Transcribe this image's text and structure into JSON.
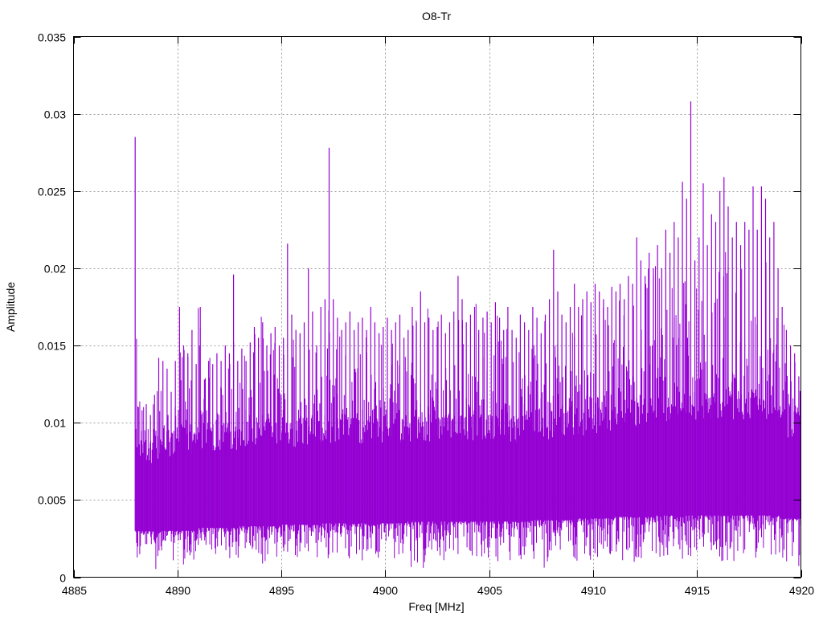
{
  "chart_data": {
    "type": "line",
    "title": "O8-Tr",
    "xlabel": "Freq [MHz]",
    "ylabel": "Amplitude",
    "xlim": [
      4885,
      4920
    ],
    "ylim": [
      0,
      0.035
    ],
    "grid": true,
    "legend": "none",
    "series_color": "#9400d3",
    "xticks": [
      4885,
      4890,
      4895,
      4900,
      4905,
      4910,
      4915,
      4920
    ],
    "xtick_labels": [
      "4885",
      "4890",
      "4895",
      "4900",
      "4905",
      "4910",
      "4915",
      "4920"
    ],
    "yticks": [
      0,
      0.005,
      0.01,
      0.015,
      0.02,
      0.025,
      0.03,
      0.035
    ],
    "ytick_labels": [
      "0",
      "0.005",
      "0.01",
      "0.015",
      "0.02",
      "0.025",
      "0.03",
      "0.035"
    ],
    "envelope": {
      "x_start": 4888.0,
      "bin_width_mhz": 0.2,
      "max": [
        0.0285,
        0.0108,
        0.0112,
        0.0105,
        0.0118,
        0.0142,
        0.014,
        0.0135,
        0.012,
        0.014,
        0.0175,
        0.015,
        0.0145,
        0.016,
        0.0138,
        0.0175,
        0.0128,
        0.014,
        0.0138,
        0.0145,
        0.014,
        0.015,
        0.0145,
        0.0196,
        0.014,
        0.0148,
        0.014,
        0.0152,
        0.0162,
        0.0155,
        0.0165,
        0.015,
        0.0158,
        0.0162,
        0.015,
        0.0155,
        0.0216,
        0.017,
        0.016,
        0.0158,
        0.0165,
        0.02,
        0.0172,
        0.015,
        0.0175,
        0.018,
        0.0278,
        0.018,
        0.0168,
        0.016,
        0.0165,
        0.0172,
        0.016,
        0.0165,
        0.0168,
        0.016,
        0.0175,
        0.0165,
        0.0158,
        0.0162,
        0.0168,
        0.016,
        0.0165,
        0.017,
        0.0155,
        0.016,
        0.0175,
        0.0165,
        0.0185,
        0.0165,
        0.0168,
        0.016,
        0.0162,
        0.017,
        0.0158,
        0.0165,
        0.0172,
        0.0195,
        0.018,
        0.0165,
        0.017,
        0.0175,
        0.016,
        0.0168,
        0.0172,
        0.0165,
        0.0178,
        0.0168,
        0.016,
        0.0175,
        0.016,
        0.0155,
        0.017,
        0.0165,
        0.016,
        0.0175,
        0.0168,
        0.0158,
        0.017,
        0.018,
        0.0212,
        0.0185,
        0.017,
        0.0165,
        0.0175,
        0.019,
        0.0175,
        0.018,
        0.0185,
        0.0178,
        0.019,
        0.0185,
        0.018,
        0.0175,
        0.0188,
        0.0185,
        0.019,
        0.018,
        0.0195,
        0.019,
        0.022,
        0.0205,
        0.0195,
        0.021,
        0.02,
        0.0215,
        0.02,
        0.0225,
        0.021,
        0.023,
        0.022,
        0.0256,
        0.0245,
        0.0308,
        0.0205,
        0.022,
        0.0255,
        0.0215,
        0.0235,
        0.023,
        0.025,
        0.0259,
        0.024,
        0.022,
        0.023,
        0.0215,
        0.023,
        0.0225,
        0.0253,
        0.0225,
        0.0253,
        0.0245,
        0.022,
        0.023,
        0.02,
        0.0175,
        0.016,
        0.015,
        0.0145,
        0.013
      ],
      "min_per_mhz": [
        0.0005,
        0.001,
        0.0005,
        0.001,
        0.001,
        0.0012,
        0.0008,
        0.0005,
        0.001,
        0.0012,
        0.0008,
        0.001,
        0.0008,
        0.0005,
        0.001,
        0.0012,
        0.001,
        0.0008,
        0.001,
        0.0005,
        0.0008,
        0.001,
        0.0012,
        0.0008,
        0.001,
        0.0012,
        0.001,
        0.0015,
        0.0008,
        0.0012,
        0.001,
        0.0005
      ],
      "core_low_per_mhz": [
        0.003,
        0.003,
        0.003,
        0.0032,
        0.0032,
        0.0033,
        0.0033,
        0.0034,
        0.0034,
        0.0035,
        0.0035,
        0.0035,
        0.0035,
        0.0036,
        0.0036,
        0.0036,
        0.0036,
        0.0036,
        0.0036,
        0.0037,
        0.0037,
        0.0038,
        0.0038,
        0.0039,
        0.0039,
        0.004,
        0.004,
        0.004,
        0.004,
        0.004,
        0.004,
        0.0038
      ],
      "core_high_per_mhz": [
        0.008,
        0.0085,
        0.0088,
        0.009,
        0.009,
        0.0092,
        0.0092,
        0.0094,
        0.0095,
        0.0095,
        0.0095,
        0.0096,
        0.0096,
        0.0097,
        0.0097,
        0.0097,
        0.0096,
        0.0096,
        0.0097,
        0.0098,
        0.01,
        0.01,
        0.0102,
        0.0104,
        0.0106,
        0.0108,
        0.011,
        0.011,
        0.011,
        0.011,
        0.0108,
        0.01
      ]
    }
  }
}
